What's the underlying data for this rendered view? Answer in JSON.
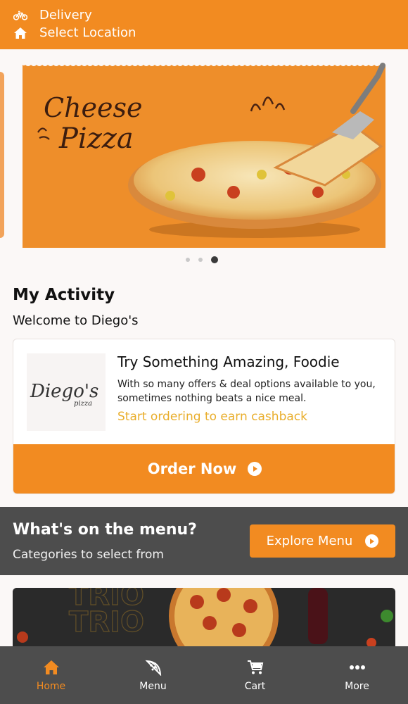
{
  "header": {
    "mode_label": "Delivery",
    "location_label": "Select Location"
  },
  "banner": {
    "title_line1": "Cheese",
    "title_line2": "Pizza",
    "active_slide": 3,
    "slide_count": 3
  },
  "activity": {
    "title": "My Activity",
    "subtitle": "Welcome to Diego's"
  },
  "promo": {
    "logo_text_main": "Diego's",
    "logo_text_sub": "pizza",
    "title": "Try Something Amazing, Foodie",
    "description": "With so many offers & deal options available to you, sometimes nothing beats a nice meal.",
    "link": "Start ordering to earn cashback",
    "button_label": "Order Now"
  },
  "menu_section": {
    "title": "What's on the menu?",
    "subtitle": "Categories to select from",
    "button_label": "Explore Menu",
    "image_watermark": "TRIO"
  },
  "nav": {
    "items": [
      {
        "label": "Home",
        "icon": "home-icon",
        "active": true
      },
      {
        "label": "Menu",
        "icon": "pizza-icon",
        "active": false
      },
      {
        "label": "Cart",
        "icon": "cart-icon",
        "active": false
      },
      {
        "label": "More",
        "icon": "more-icon",
        "active": false
      }
    ]
  },
  "colors": {
    "brand": "#f28b21",
    "dark": "#4d4d4d",
    "link": "#e9ae2c"
  }
}
